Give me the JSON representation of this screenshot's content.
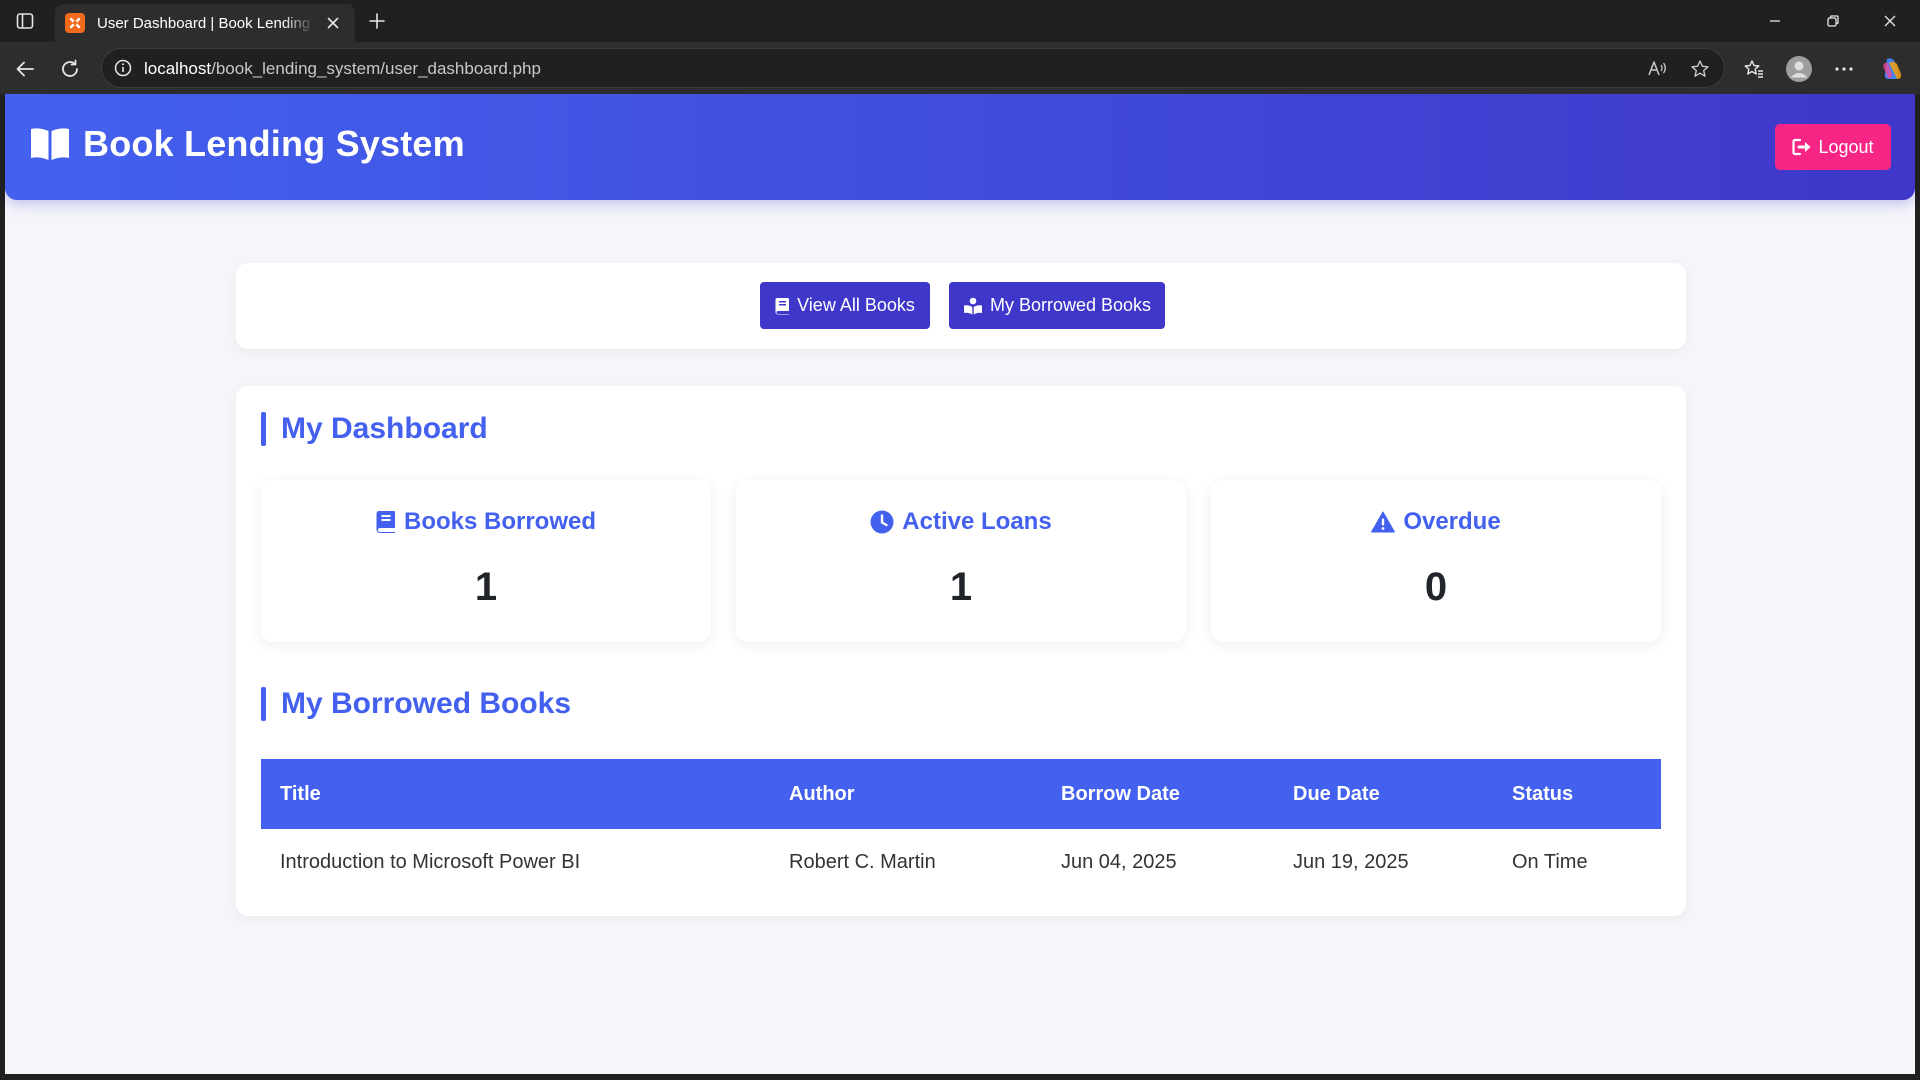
{
  "browser": {
    "tab_title": "User Dashboard | Book Lending System",
    "url_host": "localhost",
    "url_path": "/book_lending_system/user_dashboard.php"
  },
  "header": {
    "title": "Book Lending System",
    "logout_label": "Logout"
  },
  "nav": {
    "view_all_books": "View All Books",
    "my_borrowed_books": "My Borrowed Books"
  },
  "dashboard": {
    "title": "My Dashboard",
    "stats": [
      {
        "label": "Books Borrowed",
        "value": "1",
        "icon": "book-icon"
      },
      {
        "label": "Active Loans",
        "value": "1",
        "icon": "clock-icon"
      },
      {
        "label": "Overdue",
        "value": "0",
        "icon": "warning-icon"
      }
    ]
  },
  "borrowed": {
    "title": "My Borrowed Books",
    "columns": [
      "Title",
      "Author",
      "Borrow Date",
      "Due Date",
      "Status"
    ],
    "rows": [
      [
        "Introduction to Microsoft Power BI",
        "Robert C. Martin",
        "Jun 04, 2025",
        "Jun 19, 2025",
        "On Time"
      ]
    ]
  },
  "colors": {
    "primary": "#4361ee",
    "secondary": "#3f37c9",
    "danger": "#f72585",
    "page_bg": "#f5f6fa"
  }
}
